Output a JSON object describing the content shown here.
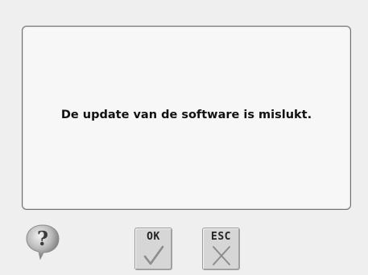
{
  "dialog": {
    "message": "De update van de software is mislukt."
  },
  "buttons": {
    "ok_label": "OK",
    "esc_label": "ESC"
  },
  "icons": {
    "help": "question-mark-icon",
    "ok": "checkmark-icon",
    "esc": "x-mark-icon"
  },
  "colors": {
    "background": "#efefef",
    "panel": "#f7f7f7",
    "button": "#d6d6d6",
    "icon_gray": "#8c8c8c"
  }
}
